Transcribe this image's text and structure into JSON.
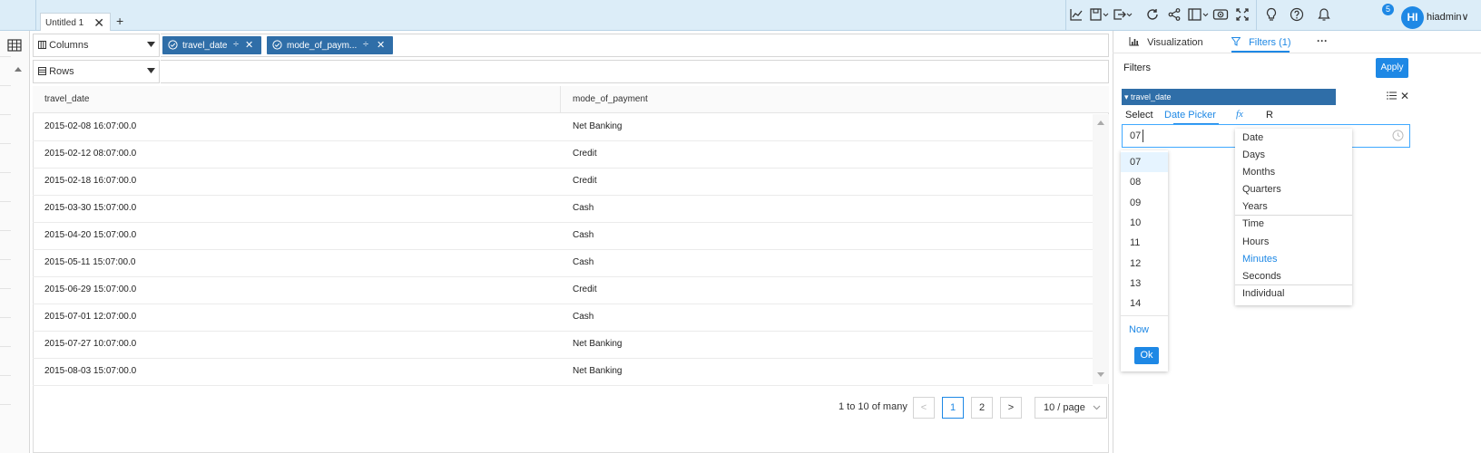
{
  "header": {
    "tab_label": "Untitled 1",
    "tab_close": "✕",
    "add_tab": "+",
    "notification_count": "5",
    "avatar_initials": "HI",
    "username": "hiadmin∨"
  },
  "shelves": {
    "columns_label": "Columns",
    "rows_label": "Rows",
    "column_chips": [
      "travel_date",
      "mode_of_paym..."
    ]
  },
  "table": {
    "headers": [
      "travel_date",
      "mode_of_payment"
    ],
    "rows": [
      [
        "2015-02-08 16:07:00.0",
        "Net Banking"
      ],
      [
        "2015-02-12 08:07:00.0",
        "Credit"
      ],
      [
        "2015-02-18 16:07:00.0",
        "Credit"
      ],
      [
        "2015-03-30 15:07:00.0",
        "Cash"
      ],
      [
        "2015-04-20 15:07:00.0",
        "Cash"
      ],
      [
        "2015-05-11 15:07:00.0",
        "Cash"
      ],
      [
        "2015-06-29 15:07:00.0",
        "Credit"
      ],
      [
        "2015-07-01 12:07:00.0",
        "Cash"
      ],
      [
        "2015-07-27 10:07:00.0",
        "Net Banking"
      ],
      [
        "2015-08-03 15:07:00.0",
        "Net Banking"
      ]
    ]
  },
  "pagination": {
    "summary": "1 to 10 of many",
    "prev": "<",
    "pages": [
      "1",
      "2"
    ],
    "current_page": "1",
    "next": ">",
    "page_size": "10 / page"
  },
  "right_panel": {
    "tab_visualization": "Visualization",
    "tab_filters": "Filters (1)",
    "more": "···",
    "filters_title": "Filters",
    "apply_label": "Apply",
    "filter_field": "▾ travel_date",
    "mode_select": "Select",
    "mode_date_picker": "Date Picker",
    "mode_fx": "fx",
    "mode_r": "R",
    "time_input_value": "07"
  },
  "time_picker": {
    "hours": [
      "07",
      "08",
      "09",
      "10",
      "11",
      "12",
      "13",
      "14"
    ],
    "now_label": "Now",
    "ok_label": "Ok"
  },
  "unit_menu": {
    "items": [
      "Date",
      "Days",
      "Months",
      "Quarters",
      "Years",
      "Time",
      "Hours",
      "Minutes",
      "Seconds",
      "Individual"
    ],
    "selected": "Minutes"
  },
  "colors": {
    "accent": "#1e88e5",
    "chip": "#2f6ea8",
    "topbar": "#dcedf8"
  }
}
